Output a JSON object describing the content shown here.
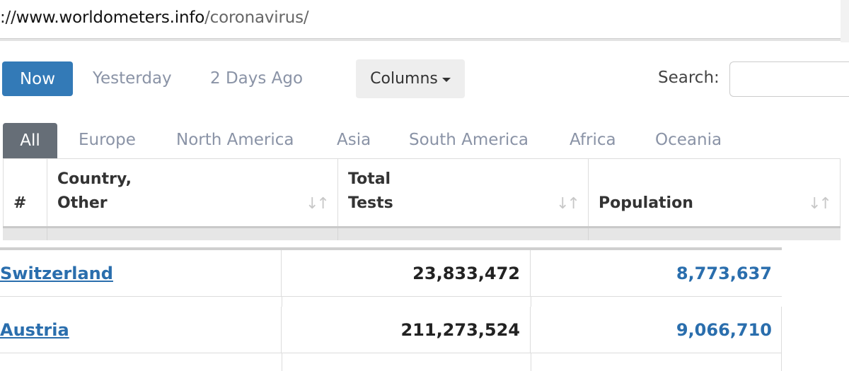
{
  "url": {
    "prefix": "://",
    "host": "www.worldometers.info",
    "path": "/coronavirus/"
  },
  "toolbar": {
    "now_label": "Now",
    "yesterday_label": "Yesterday",
    "two_days_label": "2 Days Ago",
    "columns_label": "Columns",
    "search_label": "Search:",
    "search_value": ""
  },
  "regions": [
    "All",
    "Europe",
    "North America",
    "Asia",
    "South America",
    "Africa",
    "Oceania"
  ],
  "table": {
    "headers": {
      "index": "#",
      "country_line1": "Country,",
      "country_line2": "Other",
      "tests_line1": "Total",
      "tests_line2": "Tests",
      "population": "Population"
    },
    "rows": [
      {
        "country": "Switzerland",
        "total_tests": "23,833,472",
        "population": "8,773,637"
      },
      {
        "country": "Austria",
        "total_tests": "211,273,524",
        "population": "9,066,710"
      }
    ]
  },
  "colors": {
    "accent": "#337ab7",
    "link": "#2a6ead",
    "active_tab": "#666e77"
  },
  "icons": {
    "sort": "sort-icon",
    "caret": "caret-down-icon"
  }
}
